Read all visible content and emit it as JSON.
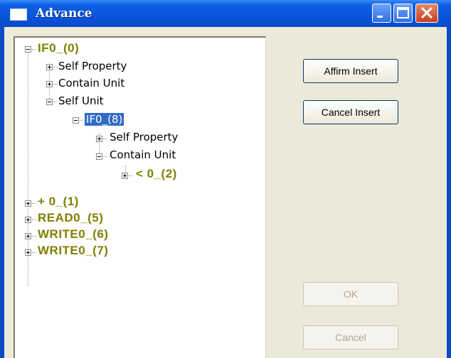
{
  "window": {
    "title": "Advance"
  },
  "tree": {
    "n0": "IF0_(0)",
    "n1": "Self Property",
    "n2": "Contain Unit",
    "n3": "Self Unit",
    "n4": "IF0_(8)",
    "n5": "Self Property",
    "n6": "Contain Unit",
    "n7": "< 0_(2)",
    "n8": "+ 0_(1)",
    "n9": "READ0_(5)",
    "n10": "WRITE0_(6)",
    "n11": "WRITE0_(7)"
  },
  "buttons": {
    "affirm": "Affirm Insert",
    "cancel_insert": "Cancel Insert",
    "ok": "OK",
    "cancel": "Cancel"
  },
  "colors": {
    "title_bar": "#0a54db",
    "node_text": "#808000",
    "selection": "#316ac5"
  }
}
